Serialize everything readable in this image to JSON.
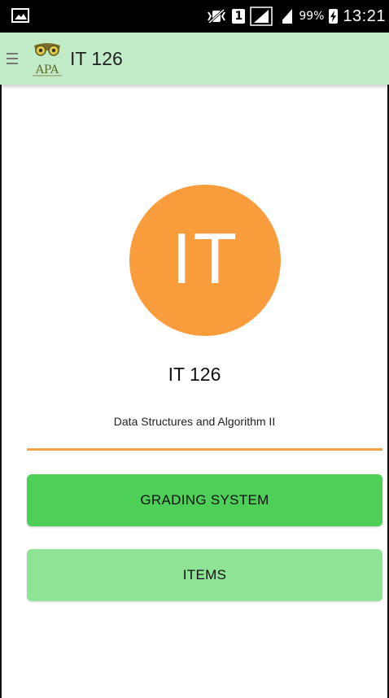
{
  "status_bar": {
    "sim_number": "1",
    "battery_percent": "99%",
    "time": "13:21"
  },
  "app_bar": {
    "logo_text": "APA",
    "title": "IT 126"
  },
  "course": {
    "avatar_initials": "IT",
    "code": "IT 126",
    "name": "Data Structures and Algorithm II"
  },
  "buttons": {
    "grading_system": "GRADING SYSTEM",
    "items": "ITEMS"
  },
  "colors": {
    "app_bar_bg": "#c2ebc7",
    "avatar_bg": "#f99d3c",
    "divider": "#f5a545",
    "grading_button": "#4ecf58",
    "items_button": "#8ee394"
  }
}
